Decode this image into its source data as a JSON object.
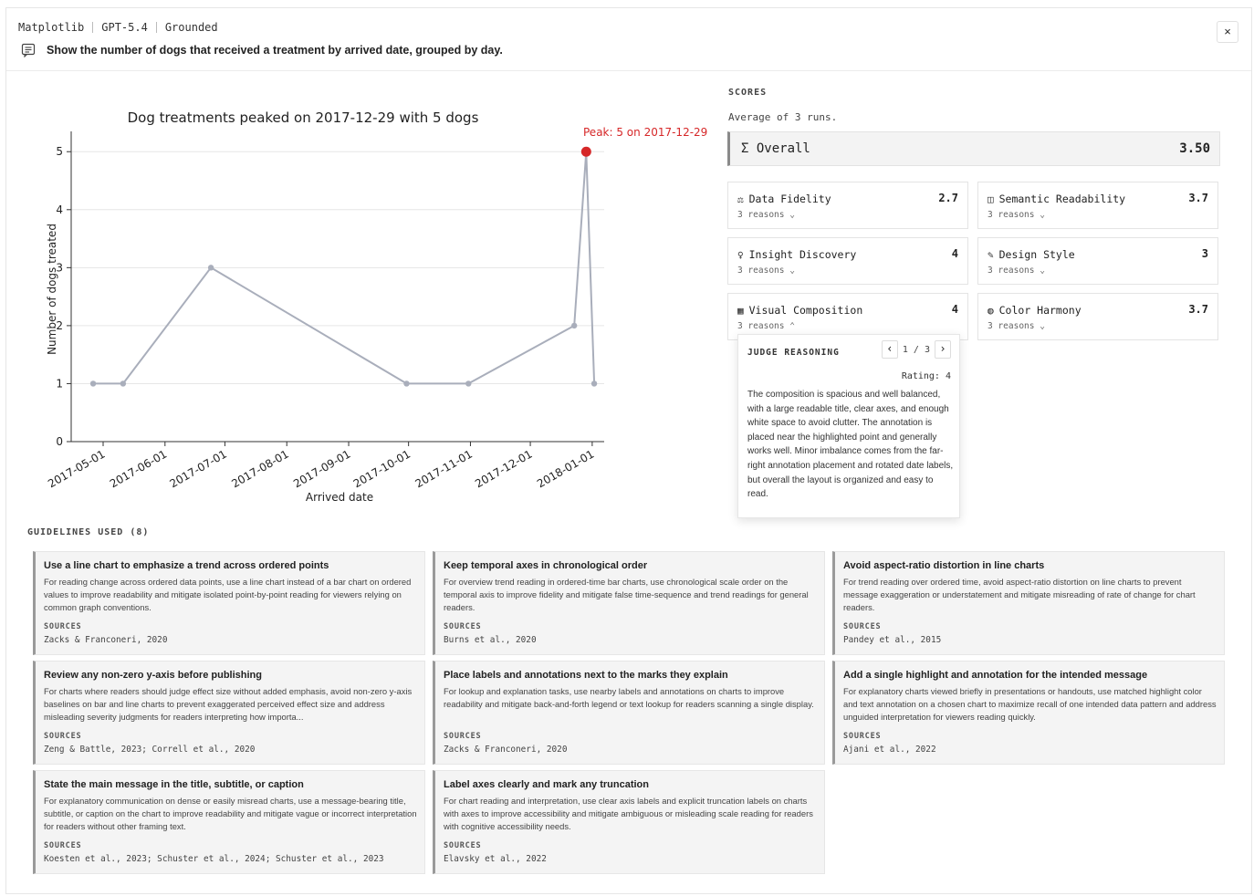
{
  "header": {
    "library": "Matplotlib",
    "model": "GPT-5.4",
    "mode": "Grounded",
    "query": "Show the number of dogs that received a treatment by arrived date, grouped by day.",
    "close_label": "×"
  },
  "chart_data": {
    "type": "line",
    "title": "Dog treatments peaked on 2017-12-29 with 5 dogs",
    "xlabel": "Arrived date",
    "ylabel": "Number of dogs treated",
    "x": [
      "2017-04-26",
      "2017-05-11",
      "2017-06-24",
      "2017-09-30",
      "2017-10-31",
      "2017-12-23",
      "2017-12-29",
      "2018-01-02"
    ],
    "values": [
      1,
      1,
      3,
      1,
      1,
      2,
      5,
      1
    ],
    "x_ticks": [
      "2017-05-01",
      "2017-06-01",
      "2017-07-01",
      "2017-08-01",
      "2017-09-01",
      "2017-10-01",
      "2017-11-01",
      "2017-12-01",
      "2018-01-01"
    ],
    "y_ticks": [
      "0",
      "1",
      "2",
      "3",
      "4",
      "5"
    ],
    "ylim": [
      0,
      5.35
    ],
    "grid": "horizontal",
    "line_color": "#a9aebb",
    "highlight_color": "#d62728",
    "annotation": "Peak: 5 on 2017-12-29"
  },
  "scores": {
    "title": "SCORES",
    "subtitle": "Average of 3 runs.",
    "overall_label": "Σ Overall",
    "overall_value": "3.50",
    "cards": [
      {
        "icon": "⚖",
        "label": "Data Fidelity",
        "value": "2.7",
        "reasons": "3 reasons ⌄"
      },
      {
        "icon": "◫",
        "label": "Semantic Readability",
        "value": "3.7",
        "reasons": "3 reasons ⌄"
      },
      {
        "icon": "♀",
        "label": "Insight Discovery",
        "value": "4",
        "reasons": "3 reasons ⌄"
      },
      {
        "icon": "✎",
        "label": "Design Style",
        "value": "3",
        "reasons": "3 reasons ⌄"
      },
      {
        "icon": "▦",
        "label": "Visual Composition",
        "value": "4",
        "reasons": "3 reasons ⌃"
      },
      {
        "icon": "◍",
        "label": "Color Harmony",
        "value": "3.7",
        "reasons": "3 reasons ⌄"
      }
    ]
  },
  "judge": {
    "title": "JUDGE REASONING",
    "page": "1 / 3",
    "prev": "‹",
    "next": "›",
    "rating": "Rating: 4",
    "text": "The composition is spacious and well balanced, with a large readable title, clear axes, and enough white space to avoid clutter. The annotation is placed near the highlighted point and generally works well. Minor imbalance comes from the far-right annotation placement and rotated date labels, but overall the layout is organized and easy to read."
  },
  "guidelines": {
    "title": "GUIDELINES USED (8)",
    "sources_label": "SOURCES",
    "items": [
      {
        "title": "Use a line chart to emphasize a trend across ordered points",
        "desc": "For reading change across ordered data points, use a line chart instead of a bar chart on ordered values to improve readability and mitigate isolated point-by-point reading for viewers relying on common graph conventions.",
        "sources": "Zacks & Franconeri, 2020"
      },
      {
        "title": "Keep temporal axes in chronological order",
        "desc": "For overview trend reading in ordered-time bar charts, use chronological scale order on the temporal axis to improve fidelity and mitigate false time-sequence and trend readings for general readers.",
        "sources": "Burns et al., 2020"
      },
      {
        "title": "Avoid aspect-ratio distortion in line charts",
        "desc": "For trend reading over ordered time, avoid aspect-ratio distortion on line charts to prevent message exaggeration or understatement and mitigate misreading of rate of change for chart readers.",
        "sources": "Pandey et al., 2015"
      },
      {
        "title": "Review any non-zero y-axis before publishing",
        "desc": "For charts where readers should judge effect size without added emphasis, avoid non-zero y-axis baselines on bar and line charts to prevent exaggerated perceived effect size and address misleading severity judgments for readers interpreting how importa...",
        "sources": "Zeng & Battle, 2023; Correll et al., 2020"
      },
      {
        "title": "Place labels and annotations next to the marks they explain",
        "desc": "For lookup and explanation tasks, use nearby labels and annotations on charts to improve readability and mitigate back-and-forth legend or text lookup for readers scanning a single display.",
        "sources": "Zacks & Franconeri, 2020"
      },
      {
        "title": "Add a single highlight and annotation for the intended message",
        "desc": "For explanatory charts viewed briefly in presentations or handouts, use matched highlight color and text annotation on a chosen chart to maximize recall of one intended data pattern and address unguided interpretation for viewers reading quickly.",
        "sources": "Ajani et al., 2022"
      },
      {
        "title": "State the main message in the title, subtitle, or caption",
        "desc": "For explanatory communication on dense or easily misread charts, use a message-bearing title, subtitle, or caption on the chart to improve readability and mitigate vague or incorrect interpretation for readers without other framing text.",
        "sources": "Koesten et al., 2023; Schuster et al., 2024; Schuster et al., 2023"
      },
      {
        "title": "Label axes clearly and mark any truncation",
        "desc": "For chart reading and interpretation, use clear axis labels and explicit truncation labels on charts with axes to improve accessibility and mitigate ambiguous or misleading scale reading for readers with cognitive accessibility needs.",
        "sources": "Elavsky et al., 2022"
      }
    ]
  }
}
